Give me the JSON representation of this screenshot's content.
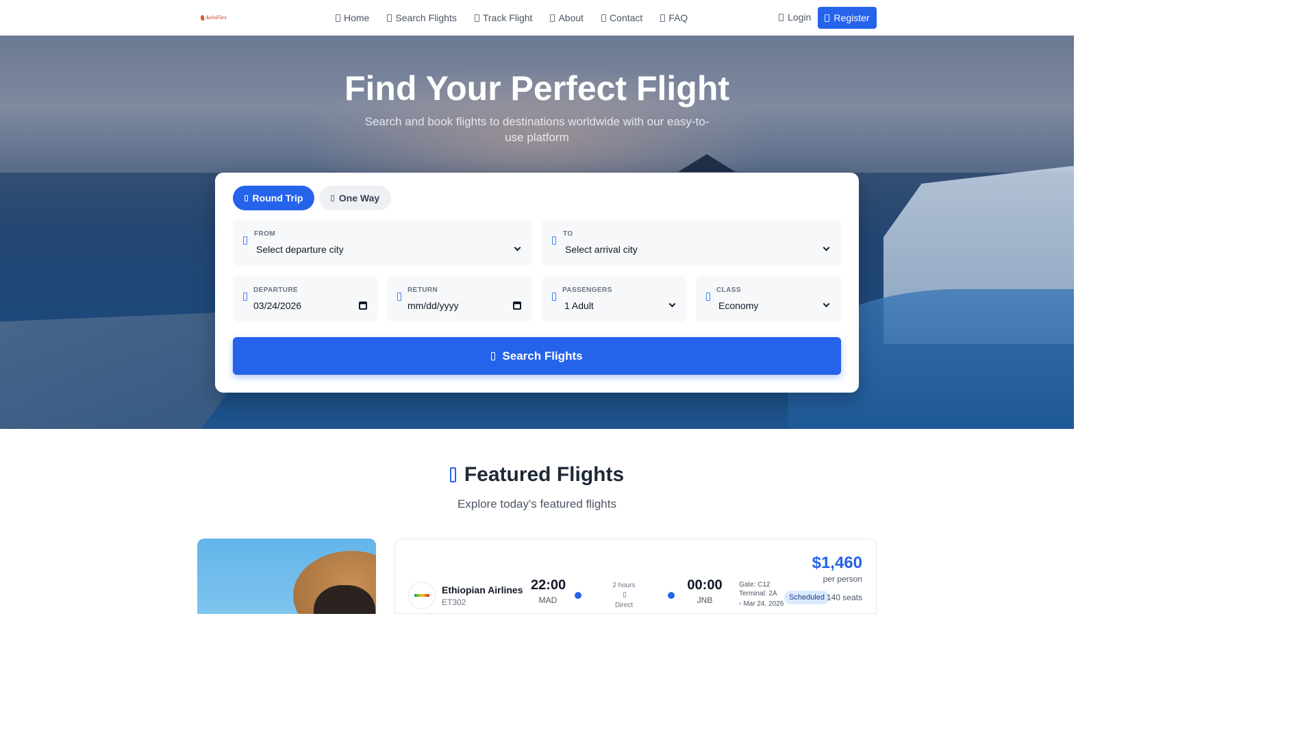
{
  "nav": {
    "logo_text": "AeloFlex",
    "links": [
      {
        "label": "Home",
        "icon": "home-icon"
      },
      {
        "label": "Search Flights",
        "icon": "search-icon"
      },
      {
        "label": "Track Flight",
        "icon": "location-icon"
      },
      {
        "label": "About",
        "icon": "info-icon"
      },
      {
        "label": "Contact",
        "icon": "envelope-icon"
      },
      {
        "label": "FAQ",
        "icon": "question-icon"
      }
    ],
    "login_label": "Login",
    "register_label": "Register"
  },
  "hero": {
    "title": "Find Your Perfect Flight",
    "subtitle": "Search and book flights to destinations worldwide with our easy-to-use platform"
  },
  "search": {
    "trip_types": [
      "Round Trip",
      "One Way"
    ],
    "selected_trip_type": "Round Trip",
    "from": {
      "label": "FROM",
      "value": "Select departure city"
    },
    "to": {
      "label": "TO",
      "value": "Select arrival city"
    },
    "departure": {
      "label": "DEPARTURE",
      "value": "03/24/2026"
    },
    "return": {
      "label": "RETURN",
      "value": "mm/dd/yyyy"
    },
    "passengers": {
      "label": "PASSENGERS",
      "value": "1 Adult"
    },
    "class": {
      "label": "CLASS",
      "value": "Economy"
    },
    "button_label": "Search Flights"
  },
  "featured": {
    "title": "Featured Flights",
    "subtitle": "Explore today's featured flights",
    "flight": {
      "airline": "Ethiopian Airlines",
      "flight_number": "ET302",
      "departure_time": "22:00",
      "departure_code": "MAD",
      "duration": "2 hours",
      "stops": "Direct",
      "arrival_time": "00:00",
      "arrival_code": "JNB",
      "gate": "Gate: C12",
      "terminal": "Terminal: 2A",
      "date": "Mar 24, 2026",
      "price": "$1,460",
      "price_note": "per person",
      "status": "Scheduled",
      "seats": "140 seats"
    }
  },
  "colors": {
    "accent": "#2563eb",
    "badge_bg": "#dbeafe"
  }
}
